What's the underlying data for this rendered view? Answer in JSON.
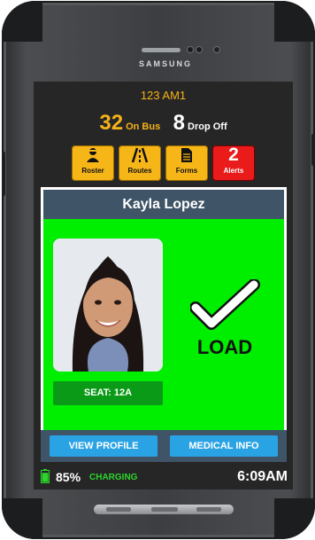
{
  "device": {
    "brand": "SAMSUNG"
  },
  "header": {
    "bus_name": "123 AM1",
    "on_bus_count": "32",
    "on_bus_label": "On Bus",
    "drop_off_count": "8",
    "drop_off_label": "Drop Off"
  },
  "tiles": [
    {
      "label": "Roster",
      "icon": "person-icon"
    },
    {
      "label": "Routes",
      "icon": "road-icon"
    },
    {
      "label": "Forms",
      "icon": "document-icon"
    },
    {
      "label": "Alerts",
      "badge": "2"
    }
  ],
  "student": {
    "name": "Kayla Lopez",
    "seat": "SEAT: 12A",
    "status": "LOAD",
    "status_color": "#00ee00"
  },
  "actions": {
    "view_profile": "VIEW PROFILE",
    "medical_info": "MEDICAL INFO"
  },
  "status_bar": {
    "battery_pct": "85%",
    "battery_level": 0.85,
    "charging": "CHARGING",
    "time": "6:09AM"
  },
  "colors": {
    "accent": "#f6b21a",
    "alert": "#ea1b1b",
    "header_bar": "#3f5467",
    "button": "#2aa3e4",
    "seat": "#0b9a17"
  }
}
